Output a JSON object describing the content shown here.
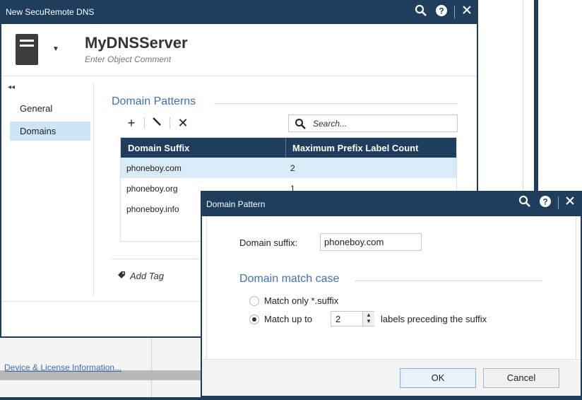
{
  "background": {
    "footer_link": "Device & License Information..."
  },
  "main_dialog": {
    "title": "New SecuRemote DNS",
    "object_name": "MyDNSServer",
    "object_comment_placeholder": "Enter Object Comment",
    "nav": [
      {
        "label": "General"
      },
      {
        "label": "Domains",
        "active": true
      }
    ],
    "section_title": "Domain Patterns",
    "search_placeholder": "Search...",
    "table": {
      "columns": [
        "Domain Suffix",
        "Maximum Prefix Label Count"
      ],
      "rows": [
        {
          "suffix": "phoneboy.com",
          "count": "2",
          "selected": true
        },
        {
          "suffix": "phoneboy.org",
          "count": "1"
        },
        {
          "suffix": "phoneboy.info",
          "count": ""
        }
      ]
    },
    "add_tag_label": "Add Tag"
  },
  "popup_dialog": {
    "title": "Domain Pattern",
    "domain_suffix_label": "Domain suffix:",
    "domain_suffix_value": "phoneboy.com",
    "section_title": "Domain match case",
    "option_match_only": "Match only *.suffix",
    "option_match_up_to": "Match up to",
    "match_up_to_value": "2",
    "labels_preceding": "labels preceding the suffix",
    "selected_option": "match_up_to",
    "ok_label": "OK",
    "cancel_label": "Cancel"
  },
  "colors": {
    "titlebar": "#1f3d5c",
    "accent_text": "#3a73b3",
    "selection": "#cde6f7"
  },
  "icons": [
    "search-icon",
    "help-icon",
    "close-icon",
    "server-icon",
    "add-icon",
    "edit-icon",
    "delete-icon",
    "tag-icon",
    "collapse-icon"
  ]
}
